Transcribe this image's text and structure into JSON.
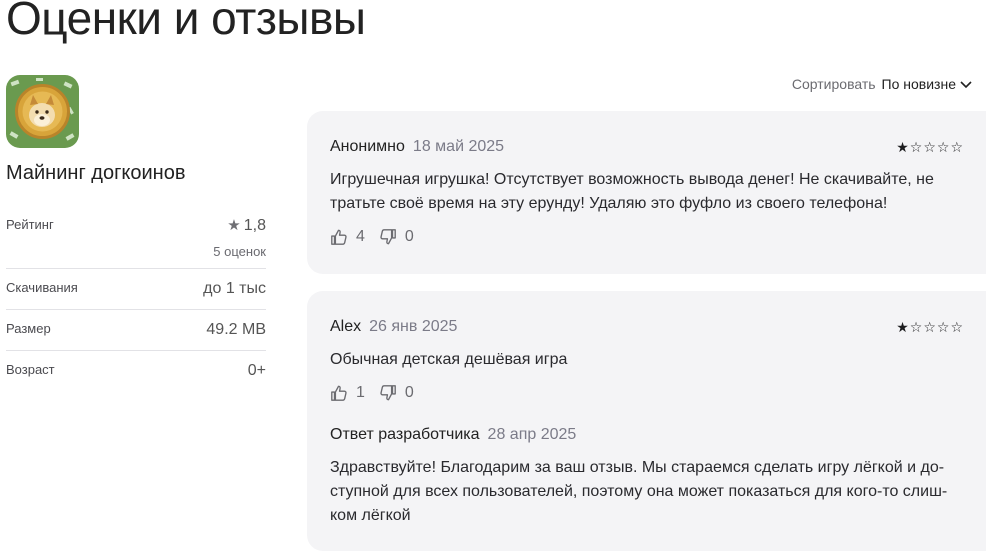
{
  "page": {
    "title": "Оценки и отзывы"
  },
  "app": {
    "name": "Майнинг догкоинов",
    "icon": "doge-coin-icon"
  },
  "stats": {
    "rating_label": "Рейтинг",
    "rating_value": "1,8",
    "rating_count": "5 оценок",
    "downloads_label": "Скачивания",
    "downloads_value": "до 1 тыс",
    "size_label": "Размер",
    "size_value": "49.2 MB",
    "age_label": "Возраст",
    "age_value": "0+"
  },
  "sort": {
    "label": "Сортировать",
    "value": "По новизне"
  },
  "reviews": [
    {
      "author": "Анонимно",
      "date": "18 май 2025",
      "stars": "★☆☆☆☆",
      "rating": 1,
      "text": "Игрушечная игрушка! Отсутствует возможность вывода денег! Не скачивайте, не тратьте своё время на эту ерунду! Удаляю это фуфло из своего телефона!",
      "likes": "4",
      "dislikes": "0"
    },
    {
      "author": "Alex",
      "date": "26 янв 2025",
      "stars": "★☆☆☆☆",
      "rating": 1,
      "text": "Обычная детская дешёвая игра",
      "likes": "1",
      "dislikes": "0",
      "reply": {
        "label": "Ответ разработчика",
        "date": "28 апр 2025",
        "text": "Здравствуйте! Благодарим за ваш отзыв. Мы стараемся сделать игру лёгкой и до-ступной для всех пользователей, поэтому она может показаться для кого-то слиш-ком лёгкой"
      }
    }
  ],
  "colors": {
    "card_bg": "#f4f4f6",
    "muted": "#7b7b88",
    "icon_bg": "#6a9a4f",
    "coin": "#d8a43a"
  }
}
